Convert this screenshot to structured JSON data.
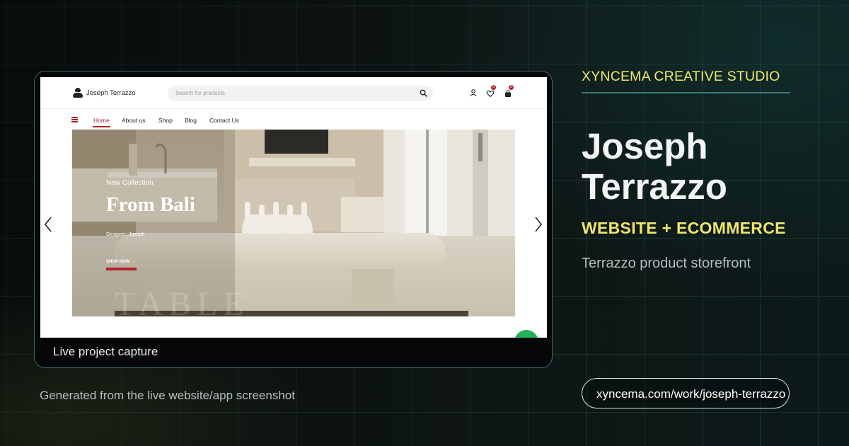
{
  "brand": {
    "studio": "XYNCEMA CREATIVE STUDIO",
    "title": "Joseph Terrazzo",
    "category": "WEBSITE + ECOMMERCE",
    "subtitle": "Terrazzo product storefront",
    "url": "xyncema.com/work/joseph-terrazzo",
    "footnote": "Generated from the live website/app screenshot",
    "caption": "Live project capture"
  },
  "colors": {
    "accent_yellow": "#f0e66e",
    "accent_teal": "#3c7a74",
    "site_red": "#b0242b",
    "background": "#0c1413"
  },
  "site": {
    "logo_text": "Joseph Terrazzo",
    "search_placeholder": "Search for products",
    "wishlist_count": "0",
    "cart_count": "0",
    "nav": [
      {
        "label": "Home"
      },
      {
        "label": "About us"
      },
      {
        "label": "Shop"
      },
      {
        "label": "Blog"
      },
      {
        "label": "Contact Us"
      }
    ],
    "hero": {
      "eyebrow": "New Collection",
      "heading": "From Bali",
      "designer": "Designer: Joseph",
      "cta": "SHOP NOW →",
      "watermark": "TABLE"
    },
    "icons": {
      "search": "search-icon",
      "account": "user-icon",
      "wishlist": "heart-icon",
      "cart": "bag-icon",
      "menu": "hamburger-icon",
      "prev": "chevron-left-icon",
      "next": "chevron-right-icon",
      "chat": "whatsapp-icon"
    }
  }
}
